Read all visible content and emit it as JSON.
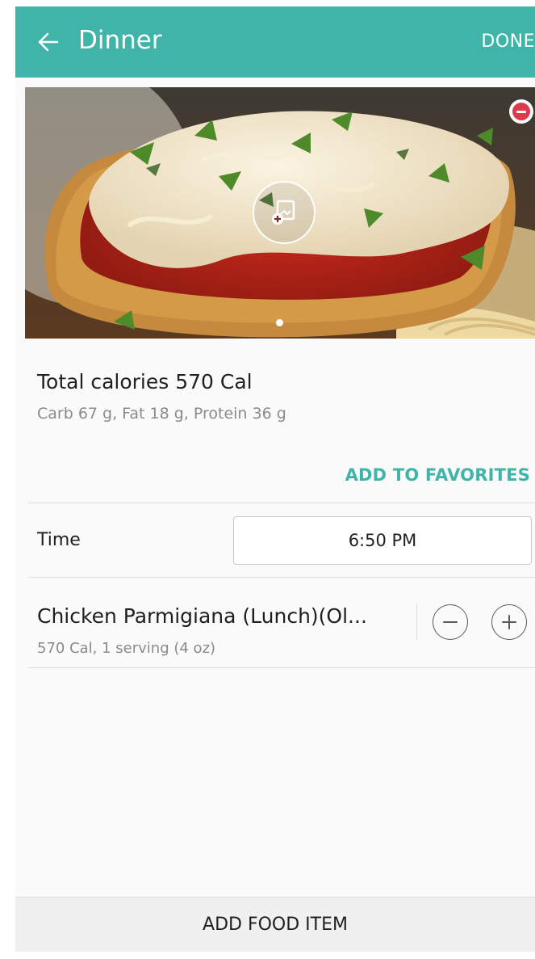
{
  "header": {
    "title": "Dinner",
    "done_label": "DONE",
    "back_icon": "arrow-left-icon"
  },
  "photo": {
    "remove_icon": "minus-circle-icon",
    "add_photo_icon": "add-image-icon",
    "description": "Chicken parmigiana with melted cheese, tomato sauce, basil and spaghetti",
    "page_dots": 1,
    "active_dot": 0
  },
  "summary": {
    "total_calories": "Total calories  570 Cal",
    "macros": "Carb 67 g, Fat 18 g, Protein 36 g",
    "add_to_favorites_label": "ADD TO FAVORITES"
  },
  "time": {
    "label": "Time",
    "value": "6:50 PM"
  },
  "food_items": [
    {
      "name": "Chicken Parmigiana (Lunch)(Ol...",
      "detail": "570 Cal, 1 serving (4 oz)",
      "decrease_icon": "minus-icon",
      "increase_icon": "plus-icon"
    }
  ],
  "footer": {
    "add_food_label": "ADD FOOD ITEM"
  },
  "colors": {
    "accent": "#40b4a8",
    "remove_red": "#e03a4a",
    "text_primary": "#1f1f1f",
    "text_secondary": "#8a8a8a"
  }
}
